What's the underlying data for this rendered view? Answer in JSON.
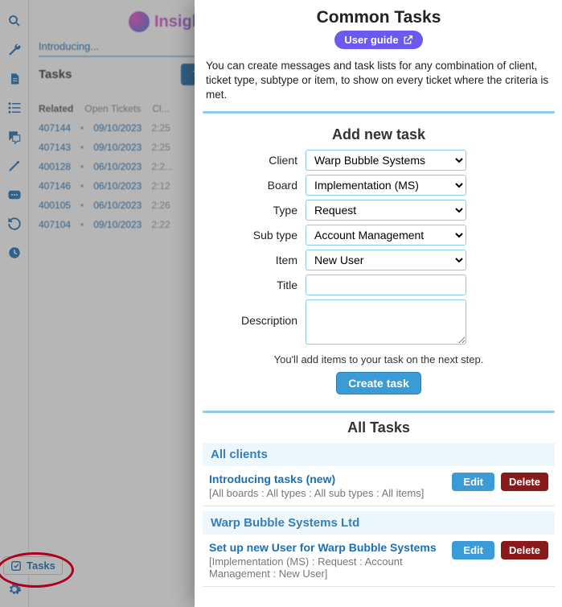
{
  "brand": {
    "name": "Insights"
  },
  "sidebar": {
    "icons": [
      "search",
      "wrench",
      "document",
      "list",
      "chat",
      "pen",
      "message",
      "history",
      "clock"
    ]
  },
  "behind": {
    "crumb": "Introducing...",
    "title": "Tasks",
    "toggle": "Toggle",
    "tabs": [
      "Related",
      "Open Tickets",
      "Cl..."
    ],
    "rows": [
      {
        "id": "407144",
        "date": "09/10/2023",
        "tail": "2:25"
      },
      {
        "id": "407143",
        "date": "09/10/2023",
        "tail": "2:25"
      },
      {
        "id": "400128",
        "date": "06/10/2023",
        "tail": "2:2..."
      },
      {
        "id": "407146",
        "date": "06/10/2023",
        "tail": "2:12"
      },
      {
        "id": "400105",
        "date": "06/10/2023",
        "tail": "2:26"
      },
      {
        "id": "407104",
        "date": "09/10/2023",
        "tail": "2:22"
      }
    ]
  },
  "footer": {
    "tasks_label": "Tasks"
  },
  "modal": {
    "title": "Common Tasks",
    "user_guide": "User guide",
    "description": "You can create messages and task lists for any combination of client, ticket type, subtype or item, to show on every ticket where the criteria is met.",
    "add": {
      "heading": "Add new task",
      "labels": {
        "client": "Client",
        "board": "Board",
        "type": "Type",
        "subtype": "Sub type",
        "item": "Item",
        "title": "Title",
        "description": "Description"
      },
      "values": {
        "client": "Warp Bubble Systems",
        "board": "Implementation (MS)",
        "type": "Request",
        "subtype": "Account Management",
        "item": "New User",
        "title": "",
        "description": ""
      },
      "hint": "You'll add items to your task on the next step.",
      "create_label": "Create task"
    },
    "all": {
      "heading": "All Tasks",
      "groups": [
        {
          "name": "All clients",
          "tasks": [
            {
              "title": "Introducing tasks (new)",
              "meta": "[All boards : All types : All sub types : All items]",
              "edit": "Edit",
              "del": "Delete"
            }
          ]
        },
        {
          "name": "Warp Bubble Systems Ltd",
          "tasks": [
            {
              "title": "Set up new User for Warp Bubble Systems",
              "meta": "[Implementation (MS) : Request : Account Management : New User]",
              "edit": "Edit",
              "del": "Delete"
            }
          ]
        }
      ]
    }
  }
}
